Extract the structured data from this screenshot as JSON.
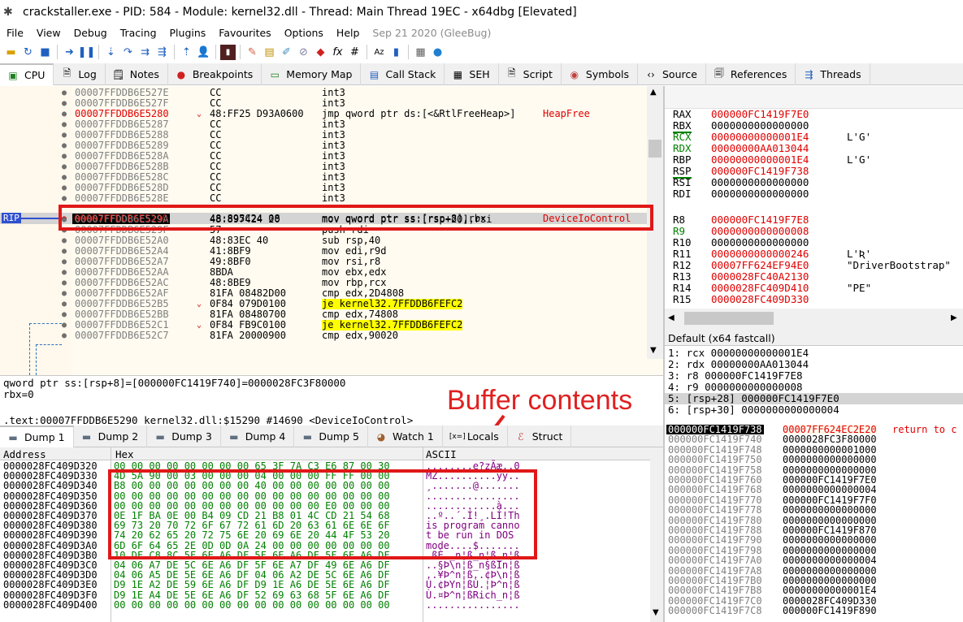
{
  "window": {
    "title": "crackstaller.exe - PID: 584 - Module: kernel32.dll - Thread: Main Thread 19EC - x64dbg [Elevated]"
  },
  "menu": {
    "items": [
      "File",
      "View",
      "Debug",
      "Tracing",
      "Plugins",
      "Favourites",
      "Options",
      "Help"
    ],
    "build_date": "Sep 21 2020 (GleeBug)"
  },
  "toolbar": {
    "icons": [
      "open-icon",
      "restart-icon",
      "stop-icon",
      "run-icon",
      "pause-icon",
      "step-into-icon",
      "step-over-icon",
      "trace-into-icon",
      "trace-over-icon",
      "execute-till-return-icon",
      "run-to-user-code-icon",
      "script-icon",
      "patch-icon",
      "comment-icon",
      "label-icon",
      "bookmark-icon",
      "function-icon",
      "hash-icon",
      "strings-icon",
      "calculator-icon",
      "globe-icon"
    ]
  },
  "tabs": [
    {
      "label": "CPU",
      "icon": "cpu-icon"
    },
    {
      "label": "Log",
      "icon": "log-icon"
    },
    {
      "label": "Notes",
      "icon": "notes-icon"
    },
    {
      "label": "Breakpoints",
      "icon": "breakpoint-icon"
    },
    {
      "label": "Memory Map",
      "icon": "memory-icon"
    },
    {
      "label": "Call Stack",
      "icon": "callstack-icon"
    },
    {
      "label": "SEH",
      "icon": "seh-icon"
    },
    {
      "label": "Script",
      "icon": "script-icon"
    },
    {
      "label": "Symbols",
      "icon": "symbols-icon"
    },
    {
      "label": "Source",
      "icon": "source-icon"
    },
    {
      "label": "References",
      "icon": "references-icon"
    },
    {
      "label": "Threads",
      "icon": "threads-icon"
    }
  ],
  "disasm": {
    "rip_label": "RIP",
    "rows": [
      {
        "addr": "00007FFDDB6E527E",
        "bytes": "CC",
        "instr": "int3",
        "cmt": ""
      },
      {
        "addr": "00007FFDDB6E527F",
        "bytes": "CC",
        "instr": "int3",
        "cmt": ""
      },
      {
        "addr": "00007FFDDB6E5280",
        "bytes": "48:FF25 D93A0600",
        "instr": "jmp qword ptr ds:[<&RtlFreeHeap>]",
        "cmt": "HeapFree"
      },
      {
        "addr": "00007FFDDB6E5287",
        "bytes": "CC",
        "instr": "int3",
        "cmt": ""
      },
      {
        "addr": "00007FFDDB6E5288",
        "bytes": "CC",
        "instr": "int3",
        "cmt": ""
      },
      {
        "addr": "00007FFDDB6E5289",
        "bytes": "CC",
        "instr": "int3",
        "cmt": ""
      },
      {
        "addr": "00007FFDDB6E528A",
        "bytes": "CC",
        "instr": "int3",
        "cmt": ""
      },
      {
        "addr": "00007FFDDB6E528B",
        "bytes": "CC",
        "instr": "int3",
        "cmt": ""
      },
      {
        "addr": "00007FFDDB6E528C",
        "bytes": "CC",
        "instr": "int3",
        "cmt": ""
      },
      {
        "addr": "00007FFDDB6E528D",
        "bytes": "CC",
        "instr": "int3",
        "cmt": ""
      },
      {
        "addr": "00007FFDDB6E528E",
        "bytes": "CC",
        "instr": "int3",
        "cmt": ""
      },
      {
        "addr": "00007FFDDB6E5290",
        "bytes": "48:895C24 08",
        "instr": "mov qword ptr ss:[rsp+8],rbx",
        "cmt": "DeviceIoControl"
      },
      {
        "addr": "00007FFDDB6E529A",
        "bytes": "48:897424 20",
        "instr": "mov qword ptr ss:[rsp+20],rsi",
        "cmt": ""
      },
      {
        "addr": "00007FFDDB6E529F",
        "bytes": "57",
        "instr": "push rdi",
        "cmt": ""
      },
      {
        "addr": "00007FFDDB6E52A0",
        "bytes": "48:83EC 40",
        "instr": "sub rsp,40",
        "cmt": ""
      },
      {
        "addr": "00007FFDDB6E52A4",
        "bytes": "41:8BF9",
        "instr": "mov edi,r9d",
        "cmt": ""
      },
      {
        "addr": "00007FFDDB6E52A7",
        "bytes": "49:8BF0",
        "instr": "mov rsi,r8",
        "cmt": ""
      },
      {
        "addr": "00007FFDDB6E52AA",
        "bytes": "8BDA",
        "instr": "mov ebx,edx",
        "cmt": ""
      },
      {
        "addr": "00007FFDDB6E52AC",
        "bytes": "48:8BE9",
        "instr": "mov rbp,rcx",
        "cmt": ""
      },
      {
        "addr": "00007FFDDB6E52AF",
        "bytes": "81FA 08482D00",
        "instr": "cmp edx,2D4808",
        "cmt": ""
      },
      {
        "addr": "00007FFDDB6E52B5",
        "bytes": "0F84 079D0100",
        "instr": "je kernel32.7FFDDB6FEFC2",
        "cmt": ""
      },
      {
        "addr": "00007FFDDB6E52BB",
        "bytes": "81FA 08480700",
        "instr": "cmp edx,74808",
        "cmt": ""
      },
      {
        "addr": "00007FFDDB6E52C1",
        "bytes": "0F84 FB9C0100",
        "instr": "je kernel32.7FFDDB6FEFC2",
        "cmt": ""
      },
      {
        "addr": "00007FFDDB6E52C7",
        "bytes": "81FA 20000900",
        "instr": "cmp edx,90020",
        "cmt": ""
      }
    ]
  },
  "info": {
    "line1": "qword ptr ss:[rsp+8]=[000000FC1419F740]=0000028FC3F80000",
    "line2": "rbx=0",
    "line3": ".text:00007FFDDB6E5290 kernel32.dll:$15290 #14690 <DeviceIoControl>"
  },
  "annotation": {
    "label": "Buffer contents"
  },
  "registers": [
    {
      "name": "RAX",
      "value": "000000FC1419F7E0",
      "comment": ""
    },
    {
      "name": "RBX",
      "value": "0000000000000000",
      "comment": ""
    },
    {
      "name": "RCX",
      "value": "00000000000001E4",
      "comment": "L'G'"
    },
    {
      "name": "RDX",
      "value": "00000000AA013044",
      "comment": ""
    },
    {
      "name": "RBP",
      "value": "00000000000001E4",
      "comment": "L'G'"
    },
    {
      "name": "RSP",
      "value": "000000FC1419F738",
      "comment": ""
    },
    {
      "name": "RSI",
      "value": "0000000000000000",
      "comment": ""
    },
    {
      "name": "RDI",
      "value": "0000000000000000",
      "comment": ""
    },
    {
      "name": "R8",
      "value": "000000FC1419F7E8",
      "comment": ""
    },
    {
      "name": "R9",
      "value": "0000000000000008",
      "comment": ""
    },
    {
      "name": "R10",
      "value": "0000000000000000",
      "comment": ""
    },
    {
      "name": "R11",
      "value": "0000000000000246",
      "comment": "L'Ʀ'"
    },
    {
      "name": "R12",
      "value": "00007FF624EF94E0",
      "comment": "\"DriverBootstrap\""
    },
    {
      "name": "R13",
      "value": "0000028FC40A2130",
      "comment": ""
    },
    {
      "name": "R14",
      "value": "0000028FC409D410",
      "comment": "\"PE\""
    },
    {
      "name": "R15",
      "value": "0000028FC409D330",
      "comment": ""
    }
  ],
  "callconv": {
    "label": "Default (x64 fastcall)",
    "args": [
      "1: rcx 00000000000001E4",
      "2: rdx 00000000AA013044",
      "3: r8 000000FC1419F7E8",
      "4: r9 0000000000000008",
      "5: [rsp+28] 000000FC1419F7E0",
      "6: [rsp+30] 0000000000000004"
    ]
  },
  "dump_tabs": [
    {
      "label": "Dump 1",
      "icon": "dump-icon"
    },
    {
      "label": "Dump 2",
      "icon": "dump-icon"
    },
    {
      "label": "Dump 3",
      "icon": "dump-icon"
    },
    {
      "label": "Dump 4",
      "icon": "dump-icon"
    },
    {
      "label": "Dump 5",
      "icon": "dump-icon"
    },
    {
      "label": "Watch 1",
      "icon": "watch-icon"
    },
    {
      "label": "Locals",
      "icon": "locals-icon"
    },
    {
      "label": "Struct",
      "icon": "struct-icon"
    }
  ],
  "dump": {
    "headers": {
      "address": "Address",
      "hex": "Hex",
      "ascii": "ASCII"
    },
    "rows": [
      {
        "addr": "0000028FC409D320",
        "hex": "00 00 00 00 00 00 00 00 65 3F 7A C3 E6 87 00 30",
        "ascii": "........e?zÃæ..0"
      },
      {
        "addr": "0000028FC409D330",
        "hex": "4D 5A 90 00 03 00 00 00 04 00 00 00 FF FF 00 00",
        "ascii": "MZ..........ÿÿ.."
      },
      {
        "addr": "0000028FC409D340",
        "hex": "B8 00 00 00 00 00 00 00 40 00 00 00 00 00 00 00",
        "ascii": "¸.......@......."
      },
      {
        "addr": "0000028FC409D350",
        "hex": "00 00 00 00 00 00 00 00 00 00 00 00 00 00 00 00",
        "ascii": "................"
      },
      {
        "addr": "0000028FC409D360",
        "hex": "00 00 00 00 00 00 00 00 00 00 00 00 E0 00 00 00",
        "ascii": "............à..."
      },
      {
        "addr": "0000028FC409D370",
        "hex": "0E 1F BA 0E 00 B4 09 CD 21 B8 01 4C CD 21 54 68",
        "ascii": "..º..´.Í!¸.LÍ!Th"
      },
      {
        "addr": "0000028FC409D380",
        "hex": "69 73 20 70 72 6F 67 72 61 6D 20 63 61 6E 6E 6F",
        "ascii": "is program canno"
      },
      {
        "addr": "0000028FC409D390",
        "hex": "74 20 62 65 20 72 75 6E 20 69 6E 20 44 4F 53 20",
        "ascii": "t be run in DOS "
      },
      {
        "addr": "0000028FC409D3A0",
        "hex": "6D 6F 64 65 2E 0D 0D 0A 24 00 00 00 00 00 00 00",
        "ascii": "mode....$......."
      },
      {
        "addr": "0000028FC409D3B0",
        "hex": "10 DF C8 8C 5F 6E A6 DF 5F 6E A6 DF 5F 6E A6 DF",
        "ascii": ".ßÈ._n¦ß_n¦ß_n¦ß"
      },
      {
        "addr": "0000028FC409D3C0",
        "hex": "04 06 A7 DE 5C 6E A6 DF 5F 6E A7 DF 49 6E A6 DF",
        "ascii": "..§Þ\\n¦ß_n§ßIn¦ß"
      },
      {
        "addr": "0000028FC409D3D0",
        "hex": "04 06 A5 DE 5E 6E A6 DF 04 06 A2 DE 5C 6E A6 DF",
        "ascii": "..¥Þ^n¦ß..¢Þ\\n¦ß"
      },
      {
        "addr": "0000028FC409D3E0",
        "hex": "D9 1E A2 DE 59 6E A6 DF D9 1E A6 DE 5E 6E A6 DF",
        "ascii": "Ù.¢ÞYn¦ßÙ.¦Þ^n¦ß"
      },
      {
        "addr": "0000028FC409D3F0",
        "hex": "D9 1E A4 DE 5E 6E A6 DF 52 69 63 68 5F 6E A6 DF",
        "ascii": "Ù.¤Þ^n¦ßRich_n¦ß"
      },
      {
        "addr": "0000028FC409D400",
        "hex": "00 00 00 00 00 00 00 00 00 00 00 00 00 00 00 00",
        "ascii": "................"
      }
    ]
  },
  "stack": {
    "rows": [
      {
        "addr": "000000FC1419F738",
        "value": "00007FF624EC2E20",
        "cmt": "return to c"
      },
      {
        "addr": "000000FC1419F740",
        "value": "0000028FC3F80000",
        "cmt": ""
      },
      {
        "addr": "000000FC1419F748",
        "value": "0000000000001000",
        "cmt": ""
      },
      {
        "addr": "000000FC1419F750",
        "value": "0000000000000000",
        "cmt": ""
      },
      {
        "addr": "000000FC1419F758",
        "value": "0000000000000000",
        "cmt": ""
      },
      {
        "addr": "000000FC1419F760",
        "value": "000000FC1419F7E0",
        "cmt": ""
      },
      {
        "addr": "000000FC1419F768",
        "value": "0000000000000004",
        "cmt": ""
      },
      {
        "addr": "000000FC1419F770",
        "value": "000000FC1419F7F0",
        "cmt": ""
      },
      {
        "addr": "000000FC1419F778",
        "value": "0000000000000000",
        "cmt": ""
      },
      {
        "addr": "000000FC1419F780",
        "value": "0000000000000000",
        "cmt": ""
      },
      {
        "addr": "000000FC1419F788",
        "value": "000000FC1419F870",
        "cmt": ""
      },
      {
        "addr": "000000FC1419F790",
        "value": "0000000000000000",
        "cmt": ""
      },
      {
        "addr": "000000FC1419F798",
        "value": "0000000000000000",
        "cmt": ""
      },
      {
        "addr": "000000FC1419F7A0",
        "value": "0000000000000004",
        "cmt": ""
      },
      {
        "addr": "000000FC1419F7A8",
        "value": "0000000000000000",
        "cmt": ""
      },
      {
        "addr": "000000FC1419F7B0",
        "value": "0000000000000000",
        "cmt": ""
      },
      {
        "addr": "000000FC1419F7B8",
        "value": "00000000000001E4",
        "cmt": ""
      },
      {
        "addr": "000000FC1419F7C0",
        "value": "0000028FC409D330",
        "cmt": ""
      },
      {
        "addr": "000000FC1419F7C8",
        "value": "000000FC1419F890",
        "cmt": ""
      }
    ]
  }
}
